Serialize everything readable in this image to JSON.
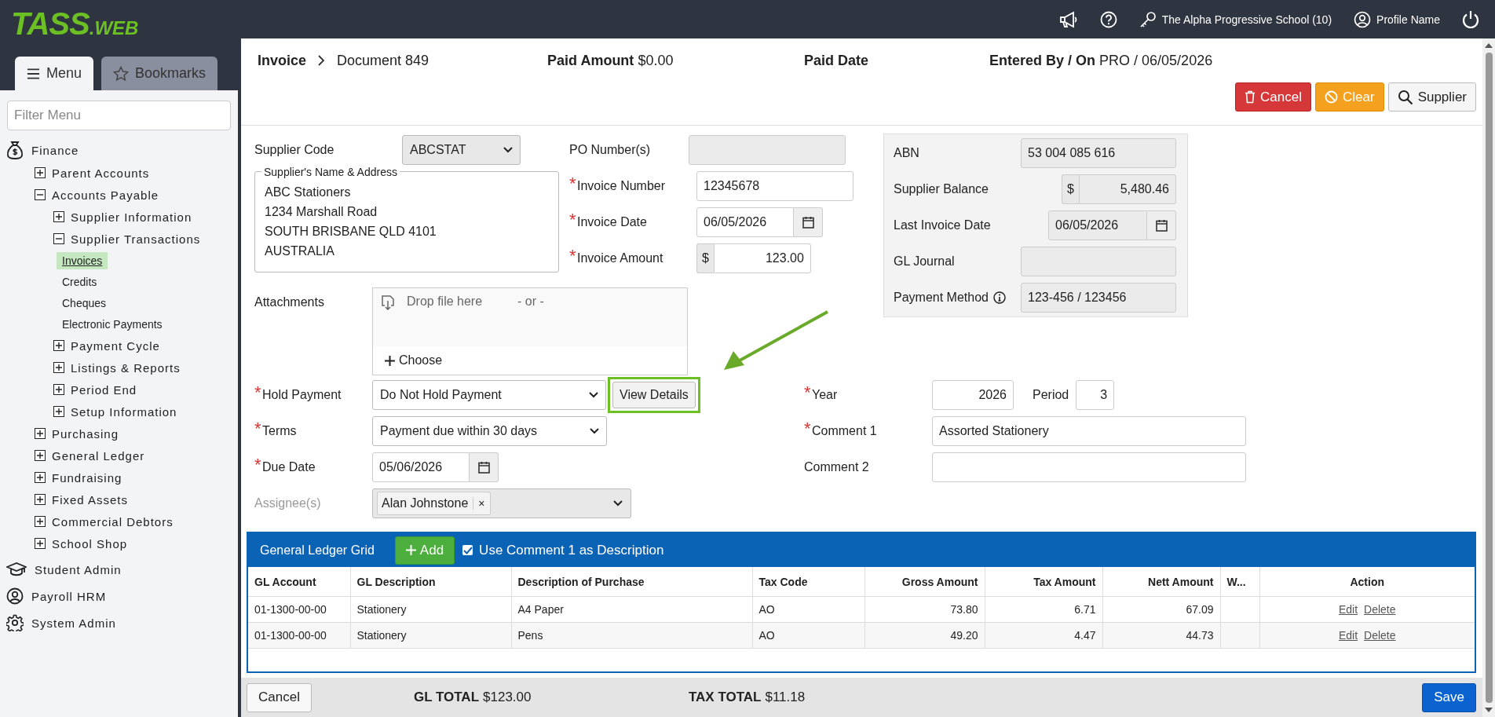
{
  "logo": {
    "main": "TASS",
    "suffix": ".WEB"
  },
  "top_bar": {
    "school": "The Alpha Progressive School (10)",
    "profile": "Profile Name"
  },
  "sidebar": {
    "tabs": [
      {
        "label": "Menu",
        "selected": true
      },
      {
        "label": "Bookmarks",
        "selected": false
      }
    ],
    "filter_placeholder": "Filter Menu",
    "modules": [
      {
        "kind": "module",
        "label": "Finance",
        "children": [
          {
            "kind": "group",
            "label": "Parent Accounts",
            "expanded": false
          },
          {
            "kind": "group",
            "label": "Accounts Payable",
            "expanded": true,
            "children": [
              {
                "kind": "group",
                "label": "Supplier Information",
                "expanded": false
              },
              {
                "kind": "group",
                "label": "Supplier Transactions",
                "expanded": true,
                "children": [
                  {
                    "kind": "link",
                    "label": "Invoices",
                    "selected": true
                  },
                  {
                    "kind": "link",
                    "label": "Credits",
                    "selected": false
                  },
                  {
                    "kind": "link",
                    "label": "Cheques",
                    "selected": false
                  },
                  {
                    "kind": "link",
                    "label": "Electronic Payments",
                    "selected": false
                  }
                ]
              },
              {
                "kind": "group",
                "label": "Payment Cycle",
                "expanded": false
              },
              {
                "kind": "group",
                "label": "Listings & Reports",
                "expanded": false
              },
              {
                "kind": "group",
                "label": "Period End",
                "expanded": false
              },
              {
                "kind": "group",
                "label": "Setup Information",
                "expanded": false
              }
            ]
          },
          {
            "kind": "group",
            "label": "Purchasing",
            "expanded": false
          },
          {
            "kind": "group",
            "label": "General Ledger",
            "expanded": false
          },
          {
            "kind": "group",
            "label": "Fundraising",
            "expanded": false
          },
          {
            "kind": "group",
            "label": "Fixed Assets",
            "expanded": false
          },
          {
            "kind": "group",
            "label": "Commercial Debtors",
            "expanded": false
          },
          {
            "kind": "group",
            "label": "School Shop",
            "expanded": false
          }
        ]
      },
      {
        "kind": "module",
        "label": "Student Admin"
      },
      {
        "kind": "module",
        "label": "Payroll HRM"
      },
      {
        "kind": "module",
        "label": "System Admin"
      }
    ]
  },
  "header": {
    "breadcrumb": [
      "Invoice",
      "Document 849"
    ],
    "stats": [
      {
        "label": "Paid Amount",
        "value": "$0.00"
      },
      {
        "label": "Paid Date"
      },
      {
        "label": "Entered By / On",
        "value": "PRO / 06/05/2026"
      }
    ],
    "buttons": [
      {
        "kind": "danger",
        "label": "Cancel"
      },
      {
        "kind": "warning",
        "label": "Clear"
      },
      {
        "kind": "default",
        "label": "Supplier"
      }
    ]
  },
  "form": {
    "required_mark": "*",
    "supplier_code": {
      "label": "Supplier Code",
      "value": "ABCSTAT"
    },
    "address": {
      "legend": "Supplier's Name & Address",
      "lines": [
        "ABC Stationers",
        "1234 Marshall Road",
        "SOUTH BRISBANE QLD 4101",
        "AUSTRALIA"
      ]
    },
    "po_numbers": {
      "label": "PO Number(s)",
      "required": false
    },
    "invoice_number": {
      "label": "Invoice Number",
      "required": true,
      "value": "12345678"
    },
    "invoice_date": {
      "label": "Invoice Date",
      "required": true,
      "value": "06/05/2026"
    },
    "invoice_amount": {
      "label": "Invoice Amount",
      "required": true,
      "prefix": "$",
      "value": "123.00"
    },
    "supplier_info": [
      {
        "kind": "text",
        "label": "ABN",
        "value": "53 004 085 616"
      },
      {
        "kind": "money",
        "label": "Supplier Balance",
        "prefix": "$",
        "value": "5,480.46"
      },
      {
        "kind": "date",
        "label": "Last Invoice Date",
        "value": "06/05/2026"
      },
      {
        "kind": "text",
        "label": "GL Journal"
      },
      {
        "kind": "text",
        "label": "Payment Method",
        "info": true,
        "value": "123-456 / 123456"
      }
    ],
    "attachments": {
      "label": "Attachments",
      "drop_text": "Drop file here",
      "or_text": "- or -",
      "choose": "Choose"
    },
    "hold_payment": {
      "label": "Hold Payment",
      "required": true,
      "value": "Do Not Hold Payment",
      "button": "View Details",
      "highlighted": true
    },
    "terms": {
      "label": "Terms",
      "required": true,
      "value": "Payment due within 30 days"
    },
    "due_date": {
      "label": "Due Date",
      "required": true,
      "value": "05/06/2026"
    },
    "assignees": {
      "label": "Assignee(s)",
      "disabled": true,
      "tags": [
        "Alan Johnstone"
      ],
      "remove": "×"
    },
    "year": {
      "label": "Year",
      "required": true,
      "value": "2026"
    },
    "period": {
      "label": "Period",
      "value": "3"
    },
    "comment_1": {
      "label": "Comment 1",
      "required": true,
      "value": "Assorted Stationery"
    },
    "comment_2": {
      "label": "Comment 2",
      "required": false
    }
  },
  "grid": {
    "title": "General Ledger Grid",
    "add": "Add",
    "use_comment": {
      "label": "Use Comment 1 as Description",
      "checked": true
    },
    "columns": [
      "GL Account",
      "GL Description",
      "Description of Purchase",
      "Tax Code",
      "Gross Amount",
      "Tax Amount",
      "Nett Amount",
      "W...",
      "Action"
    ],
    "rows": [
      {
        "cells": [
          "01-1300-00-00",
          "Stationery",
          "A4 Paper",
          "AO",
          "73.80",
          "6.71",
          "67.09",
          ""
        ],
        "actions": [
          "Edit",
          "Delete"
        ]
      },
      {
        "cells": [
          "01-1300-00-00",
          "Stationery",
          "Pens",
          "AO",
          "49.20",
          "4.47",
          "44.73",
          ""
        ],
        "actions": [
          "Edit",
          "Delete"
        ]
      }
    ]
  },
  "footer": {
    "cancel": "Cancel",
    "totals": [
      {
        "label": "GL TOTAL",
        "value": "$123.00"
      },
      {
        "label": "TAX TOTAL",
        "value": "$11.18"
      }
    ],
    "save": "Save"
  }
}
